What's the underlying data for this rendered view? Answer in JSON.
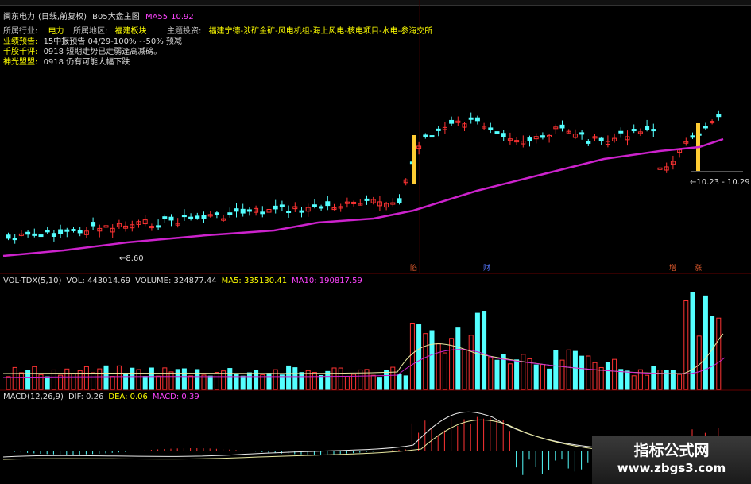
{
  "header": {
    "stock_name": "闽东电力",
    "period": "(日线,前复权)",
    "template": "B05大盘主图",
    "ma_label": "MA55",
    "ma_value": "10.92"
  },
  "info_rows": [
    {
      "k1": "所属行业:",
      "v1": "电力",
      "k2": "所属地区:",
      "v2": "福建板块",
      "k3": "主题投资:",
      "v3": "福建宁德-涉矿金矿-风电机组-海上风电-核电项目-水电-参海交所"
    },
    {
      "k1": "业绩预告:",
      "v1": "15中报预告 04/29-100%~-50% 预减",
      "k2": "",
      "v2": "",
      "k3": "",
      "v3": ""
    },
    {
      "k1": "千股千评:",
      "v1": "0918 短期走势已走弱逢高减磅。",
      "k2": "",
      "v2": "",
      "k3": "",
      "v3": ""
    },
    {
      "k1": "神光盟盟:",
      "v1": "0918 仍有可能大幅下跌",
      "k2": "",
      "v2": "",
      "k3": "",
      "v3": ""
    }
  ],
  "price_annotations": {
    "low": "8.60",
    "high_range": "10.23 - 10.29"
  },
  "event_markers": [
    "陷",
    "财",
    "增",
    "涨"
  ],
  "volume_indicator": {
    "name": "VOL-TDX(5,10)",
    "vol": "VOL: 443014.69",
    "volume": "VOLUME: 324877.44",
    "ma5": "MA5: 335130.41",
    "ma10": "MA10: 190817.59"
  },
  "macd_indicator": {
    "name": "MACD(12,26,9)",
    "dif": "DIF: 0.26",
    "dea": "DEA: 0.06",
    "macd": "MACD: 0.39"
  },
  "watermark": {
    "title": "指标公式网",
    "url": "www.zbgs3.com"
  },
  "colors": {
    "up": "#ff3333",
    "down": "#54ffff",
    "ma": "#cc22cc",
    "yellow": "#ffcc33"
  }
}
